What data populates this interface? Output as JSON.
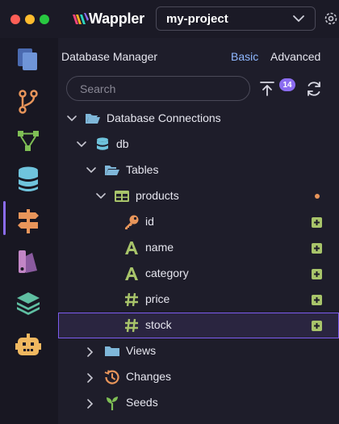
{
  "app": {
    "brand": "Wappler",
    "project": "my-project"
  },
  "panel": {
    "title": "Database Manager",
    "tabs": {
      "basic": "Basic",
      "advanced": "Advanced"
    },
    "search_placeholder": "Search",
    "pending_count": "14"
  },
  "tree": {
    "root": "Database Connections",
    "connection": "db",
    "tables_folder": "Tables",
    "table": "products",
    "columns": [
      {
        "name": "id",
        "type": "key"
      },
      {
        "name": "name",
        "type": "text"
      },
      {
        "name": "category",
        "type": "text"
      },
      {
        "name": "price",
        "type": "number"
      },
      {
        "name": "stock",
        "type": "number"
      }
    ],
    "views_folder": "Views",
    "changes_folder": "Changes",
    "seeds_folder": "Seeds"
  },
  "colors": {
    "accent": "#8b6cf0",
    "folder": "#7fb7d9",
    "column_icon": "#a8c46a",
    "key_icon": "#e8955a",
    "changes_icon": "#e8955a",
    "seeds_icon": "#7fbf55"
  }
}
